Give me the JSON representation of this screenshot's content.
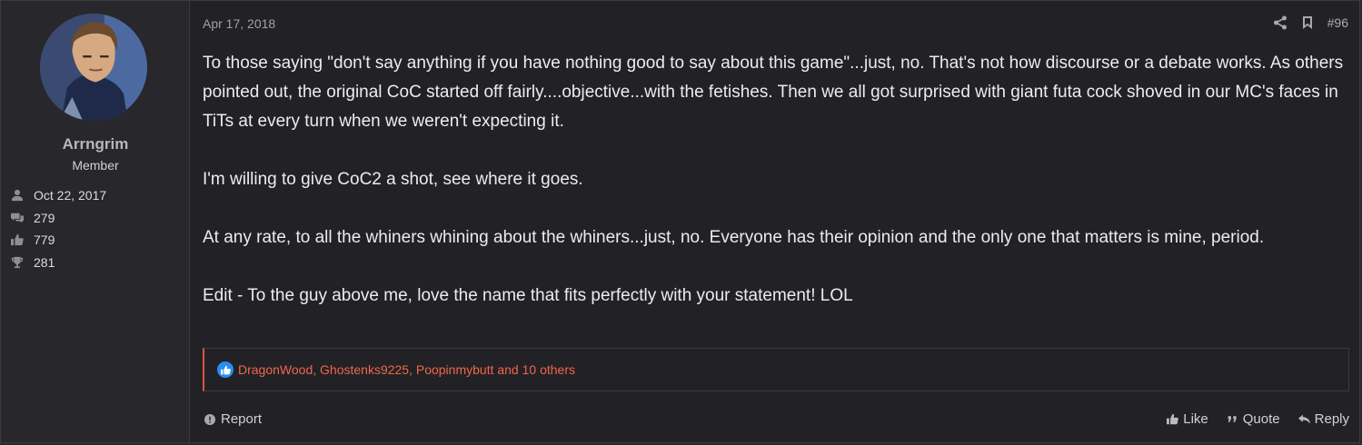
{
  "post": {
    "date": "Apr 17, 2018",
    "number": "#96",
    "paragraphs": [
      "To those saying \"don't say anything if you have nothing good to say about this game\"...just, no. That's not how discourse or a debate works. As others pointed out, the original CoC started off fairly....objective...with the fetishes. Then we all got surprised with giant futa cock shoved in our MC's faces in TiTs at every turn when we weren't expecting it.",
      "I'm willing to give CoC2 a shot, see where it goes.",
      "At any rate, to all the whiners whining about the whiners...just, no. Everyone has their opinion and the only one that matters is mine, period.",
      "Edit - To the guy above me, love the name that fits perfectly with your statement! LOL"
    ],
    "reactions_text": "DragonWood, Ghostenks9225, Poopinmybutt and 10 others",
    "report_label": "Report",
    "like_label": "Like",
    "quote_label": "Quote",
    "reply_label": "Reply"
  },
  "user": {
    "name": "Arrngrim",
    "title": "Member",
    "stats": [
      {
        "icon": "user-icon",
        "value": "Oct 22, 2017"
      },
      {
        "icon": "comments-icon",
        "value": "279"
      },
      {
        "icon": "thumbs-up-icon",
        "value": "779"
      },
      {
        "icon": "trophy-icon",
        "value": "281"
      }
    ]
  },
  "colors": {
    "background": "#222226",
    "reaction_link": "#f0654b",
    "reaction_accent": "#d9563c",
    "like_badge": "#2a8cf4"
  }
}
